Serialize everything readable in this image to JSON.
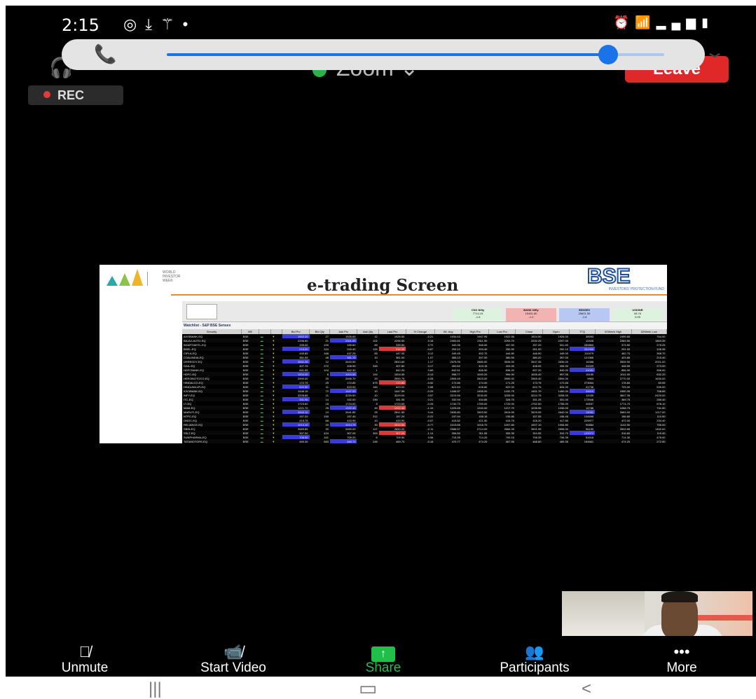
{
  "status_bar": {
    "time": "2:15",
    "left_icons": [
      "whatsapp-icon",
      "download-icon",
      "magic-wand-icon",
      "dot-icon"
    ],
    "right_icons": [
      "alarm-icon",
      "wifi-icon",
      "volte-signal-icon",
      "battery-icon"
    ]
  },
  "header": {
    "app_title": "Zoom",
    "leave_label": "Leave",
    "rec_label": "REC"
  },
  "call_overlay": {
    "volume_level": 0.82
  },
  "slide": {
    "title": "e-trading Screen",
    "left_logo_text": "WORLD INVESTOR WEEK",
    "bse_logo": "BSE",
    "bse_tagline": "INVESTORS' PROTECTION FUND",
    "watchlist_label": "Watchlist - S&P BSE Sensex",
    "indices": [
      {
        "name": "CNX Nifty",
        "value": "7714.15",
        "change": "-1.6",
        "color": "#dff2df"
      },
      {
        "name": "BANK Nifty",
        "value": "15451.80",
        "change": "-1.2",
        "color": "#f4b3b3"
      },
      {
        "name": "SENSEX",
        "value": "25601.55",
        "change": "-1.8",
        "color": "#b9c8f3"
      },
      {
        "name": "USDINR",
        "value": "58.76",
        "change": "0.05",
        "color": "#dff2df"
      }
    ],
    "table_headers": [
      "Security",
      "ME",
      "",
      "",
      "Bid Prc",
      "Bid Qty",
      "Ask Prc",
      "Ask Qty",
      "Last Prc",
      "% Change",
      "Wt. Avg",
      "High Prc",
      "Low Prc",
      "Close",
      "Open",
      "TTQ",
      "52Week High",
      "52Week Low"
    ],
    "rows": [
      [
        "AXISBANK-EQ",
        "BSE",
        "1922.20",
        "27",
        "1926.65",
        "12",
        "1926.50",
        "-0.21",
        "1934.63",
        "1947.95",
        "1922.55",
        "1924.50",
        "1926.00",
        "38593",
        "1999.65",
        "764.00"
      ],
      [
        "BAJAJ-AUTO-EQ",
        "BSE",
        "2296.50",
        "21",
        "2301.00",
        "102",
        "2296.50",
        "0.18",
        "2300.61",
        "2311.90",
        "2293.70",
        "2292.25",
        "2297.00",
        "12426",
        "2363.90",
        "1863.35"
      ],
      [
        "BHARTIARTL-EQ",
        "BSE",
        "339.00",
        "100",
        "339.60",
        "83",
        "339.60",
        "0.72",
        "342.06",
        "346.00",
        "337.50",
        "337.20",
        "341.50",
        "250860",
        "373.50",
        "279.25"
      ],
      [
        "BHEL-EQ",
        "BSE",
        "216.00",
        "224",
        "216.40",
        "100",
        "216.20",
        "-0.87",
        "253.12",
        "253.40",
        "250.50",
        "251.00",
        "252.10",
        "251955",
        "291.00",
        "106.35"
      ],
      [
        "CIPLA-EQ",
        "BSE",
        "445.85",
        "166",
        "447.25",
        "65",
        "447.00",
        "0.12",
        "449.45",
        "452.70",
        "444.80",
        "446.50",
        "449.00",
        "110479",
        "462.70",
        "368.70"
      ],
      [
        "COALINDIA-EQ",
        "BSE",
        "361.05",
        "48",
        "361.70",
        "10",
        "361.00",
        "1.07",
        "385.13",
        "397.00",
        "380.55",
        "380.20",
        "397.00",
        "121366",
        "423.85",
        "215.40"
      ],
      [
        "DRREDDY-EQ",
        "BSE",
        "2641.25",
        "12",
        "2643.55",
        "3",
        "2643.60",
        "1.17",
        "2575.95",
        "2680.00",
        "2636.00",
        "2637.35",
        "2636.00",
        "16368",
        "2839.90",
        "2021.00"
      ],
      [
        "GAIL-EQ",
        "BSE",
        "407.75",
        "272",
        "408.90",
        "345",
        "407.80",
        "0.17",
        "400.62",
        "404.15",
        "404.00",
        "408.05",
        "406.00",
        "24329",
        "448.55",
        "273.00"
      ],
      [
        "HDFCBANK-EQ",
        "BSE",
        "841.95",
        "104",
        "842.30",
        "1",
        "842.25",
        "0.60",
        "842.51",
        "846.90",
        "836.20",
        "837.20",
        "840.00",
        "41051",
        "856.90",
        "598.00"
      ],
      [
        "HDFC-EQ",
        "BSE",
        "1004.00",
        "8",
        "1004.55",
        "100",
        "1004.55",
        "-0.13",
        "998.77",
        "1000.20",
        "994.90",
        "1005.40",
        "997.35",
        "15150",
        "1011.00",
        "632.20"
      ],
      [
        "HEROMOTOCO-EQ",
        "BSE",
        "2590.00",
        "20",
        "2595.70",
        "20",
        "2590.75",
        "-0.28",
        "2505.49",
        "2623.00",
        "2590.00",
        "2569.40",
        "2594.00",
        "9963",
        "2770.00",
        "1630.00"
      ],
      [
        "HINDALCO-EQ",
        "BSE",
        "172.75",
        "25",
        "172.85",
        "675",
        "172.85",
        "-0.52",
        "172.66",
        "174.00",
        "171.25",
        "173.75",
        "172.85",
        "273064",
        "178.60",
        "83.95"
      ],
      [
        "HINDUNILVR-EQ",
        "BSE",
        "622.90",
        "11",
        "623.00",
        "160",
        "623.00",
        "0.56",
        "624.63",
        "628.80",
        "622.00",
        "622.75",
        "626.00",
        "41736",
        "725.00",
        "535.00"
      ],
      [
        "ICICIBANK-EQ",
        "BSE",
        "1446.15",
        "72",
        "1447.00",
        "10",
        "1447.55",
        "-0.29",
        "1446.57",
        "1455.00",
        "1432.75",
        "1451.70",
        "1450.00",
        "34619",
        "1550.35",
        "758.85"
      ],
      [
        "INFY-EQ",
        "BSE",
        "3228.85",
        "11",
        "3229.50",
        "10",
        "3229.00",
        "0.57",
        "3219.55",
        "3230.00",
        "3205.00",
        "3210.75",
        "3208.00",
        "12035",
        "3847.35",
        "2420.00"
      ],
      [
        "ITC-EQ",
        "BSE",
        "331.90",
        "14",
        "332.00",
        "290",
        "331.95",
        "0.21",
        "332.94",
        "334.85",
        "328.75",
        "331.25",
        "331.00",
        "173946",
        "369.75",
        "285.40"
      ],
      [
        "LT-EQ",
        "BSE",
        "1723.60",
        "18",
        "1724.00",
        "8",
        "1723.65",
        "-0.26",
        "1740.73",
        "1759.00",
        "1720.00",
        "1752.50",
        "1755.00",
        "40637",
        "1774.70",
        "678.10"
      ],
      [
        "M&M-EQ",
        "BSE",
        "1221.70",
        "25",
        "1222.40",
        "49",
        "1222.40",
        "-1.10",
        "1225.65",
        "1240.00",
        "1217.70",
        "1235.95",
        "1240.00",
        "14786",
        "1268.75",
        "741.50"
      ],
      [
        "MARUTI-EQ",
        "BSE",
        "2640.10",
        "10",
        "2641.85",
        "25",
        "2641.55",
        "0.44",
        "2635.80",
        "2653.50",
        "2615.55",
        "2629.95",
        "2640.00",
        "19051",
        "2683.00",
        "1217.00"
      ],
      [
        "NTPC-EQ",
        "BSE",
        "157.20",
        "150",
        "157.40",
        "212",
        "157.20",
        "-0.22",
        "157.94",
        "158.15",
        "155.85",
        "157.55",
        "156.45",
        "134596",
        "156.80",
        "110.90"
      ],
      [
        "ONGC-EQ",
        "BSE",
        "415.75",
        "66",
        "415.95",
        "10",
        "415.90",
        "-0.57",
        "415.82",
        "421.50",
        "415.75",
        "418.20",
        "417.80",
        "229977",
        "472.00",
        "234.40"
      ],
      [
        "RELIANCE-EQ",
        "BSE",
        "1014.10",
        "20",
        "1014.70",
        "30",
        "1014.50",
        "-0.77",
        "1013.65",
        "1016.70",
        "1007.80",
        "1007.10",
        "1006.80",
        "90884",
        "1142.50",
        "765.00"
      ],
      [
        "SBIN-EQ",
        "BSE",
        "2689.85",
        "30",
        "2690.00",
        "107",
        "2690.00",
        "-2.11",
        "2688.57",
        "2714.00",
        "2684.05",
        "2691.95",
        "2696.00",
        "56159",
        "2833.85",
        "1452.00"
      ],
      [
        "SSLT-EQ",
        "BSE",
        "307.00",
        "424",
        "307.05",
        "300",
        "307.05",
        "-1.14",
        "306.50",
        "311.55",
        "305.35",
        "310.55",
        "310.70",
        "133072",
        "316.60",
        "119.40"
      ],
      [
        "SUNPHARMA-EQ",
        "BSE",
        "708.50",
        "161",
        "709.20",
        "6",
        "709.50",
        "0.56",
        "715.35",
        "714.20",
        "700.15",
        "706.35",
        "706.35",
        "51618",
        "714.30",
        "475.00"
      ],
      [
        "TATAMOTORS-EQ",
        "BSE",
        "469.30",
        "583",
        "469.70",
        "245",
        "469.70",
        "-0.18",
        "470.77",
        "474.20",
        "467.55",
        "468.80",
        "469.35",
        "154661",
        "474.20",
        "272.50"
      ],
      [
        "TATAPOWER-EQ",
        "BSE",
        "106.70",
        "300",
        "106.75",
        "373",
        "106.75",
        "-0.14",
        "107.56",
        "108.20",
        "106.40",
        "106.90",
        "107.30",
        "201299",
        "115.25",
        "65.00"
      ]
    ]
  },
  "toolbar": {
    "unmute": "Unmute",
    "start_video": "Start Video",
    "share": "Share",
    "participants": "Participants",
    "more": "More"
  },
  "colors": {
    "share_green": "#1fbf4a",
    "leave_red": "#e02828",
    "volume_blue": "#1a73e8"
  }
}
